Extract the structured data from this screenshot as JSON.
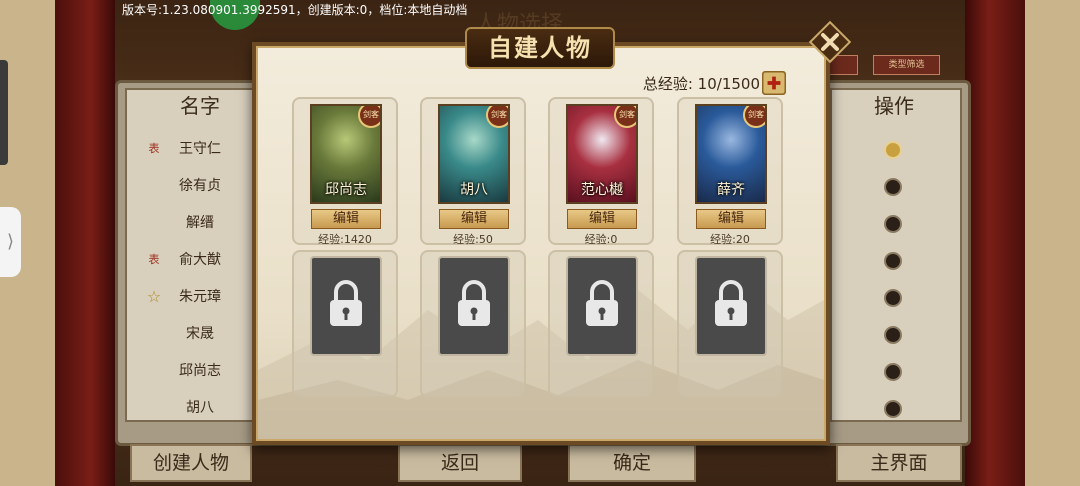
{
  "status_bar": {
    "version_text": "版本号:1.23.080901.3992591，创建版本:0，档位:本地自动档"
  },
  "background": {
    "title": "人物选择",
    "list_header": "名字",
    "ops_header": "操作",
    "filter_label": "类型筛选",
    "list_items": [
      {
        "name": "王守仁",
        "mark": "表"
      },
      {
        "name": "徐有贞",
        "mark": ""
      },
      {
        "name": "解缙",
        "mark": ""
      },
      {
        "name": "俞大猷",
        "mark": "表"
      },
      {
        "name": "朱元璋",
        "mark": "star"
      },
      {
        "name": "宋晟",
        "mark": ""
      },
      {
        "name": "邱尚志",
        "mark": ""
      },
      {
        "name": "胡八",
        "mark": ""
      }
    ],
    "bottom_buttons": {
      "create": "创建人物",
      "back": "返回",
      "confirm": "确定",
      "main": "主界面"
    }
  },
  "modal": {
    "title": "自建人物",
    "total_exp_label": "总经验:",
    "total_exp_value": "10/1500",
    "edit_label": "编辑",
    "exp_prefix": "经验:",
    "characters": [
      {
        "name": "邱尚志",
        "exp": "1420",
        "badge": "剑客",
        "palette": [
          "#2a3a1c",
          "#6a7a3a",
          "#b8c878"
        ]
      },
      {
        "name": "胡八",
        "exp": "50",
        "badge": "剑客",
        "palette": [
          "#1a3a40",
          "#3a8a8a",
          "#a8d8c8"
        ]
      },
      {
        "name": "范心樾",
        "exp": "0",
        "badge": "剑客",
        "palette": [
          "#5a1020",
          "#a83040",
          "#f0e8f0"
        ]
      },
      {
        "name": "薛齐",
        "exp": "20",
        "badge": "剑客",
        "palette": [
          "#1a2a4a",
          "#2a5a9a",
          "#9ab8e0"
        ]
      }
    ],
    "locked_slots": 4
  },
  "colors": {
    "modal_border": "#6b4a24",
    "accent_gold": "#c9a86a",
    "plus_red": "#b02010"
  }
}
